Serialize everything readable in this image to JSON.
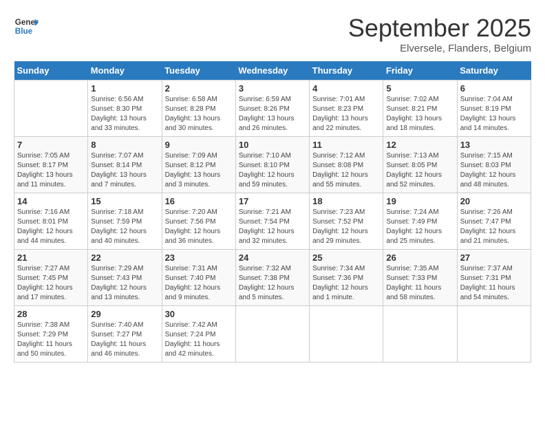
{
  "header": {
    "logo_line1": "General",
    "logo_line2": "Blue",
    "month": "September 2025",
    "location": "Elversele, Flanders, Belgium"
  },
  "days_of_week": [
    "Sunday",
    "Monday",
    "Tuesday",
    "Wednesday",
    "Thursday",
    "Friday",
    "Saturday"
  ],
  "weeks": [
    [
      null,
      {
        "num": "1",
        "sunrise": "6:56 AM",
        "sunset": "8:30 PM",
        "daylight": "13 hours and 33 minutes."
      },
      {
        "num": "2",
        "sunrise": "6:58 AM",
        "sunset": "8:28 PM",
        "daylight": "13 hours and 30 minutes."
      },
      {
        "num": "3",
        "sunrise": "6:59 AM",
        "sunset": "8:26 PM",
        "daylight": "13 hours and 26 minutes."
      },
      {
        "num": "4",
        "sunrise": "7:01 AM",
        "sunset": "8:23 PM",
        "daylight": "13 hours and 22 minutes."
      },
      {
        "num": "5",
        "sunrise": "7:02 AM",
        "sunset": "8:21 PM",
        "daylight": "13 hours and 18 minutes."
      },
      {
        "num": "6",
        "sunrise": "7:04 AM",
        "sunset": "8:19 PM",
        "daylight": "13 hours and 14 minutes."
      }
    ],
    [
      {
        "num": "7",
        "sunrise": "7:05 AM",
        "sunset": "8:17 PM",
        "daylight": "13 hours and 11 minutes."
      },
      {
        "num": "8",
        "sunrise": "7:07 AM",
        "sunset": "8:14 PM",
        "daylight": "13 hours and 7 minutes."
      },
      {
        "num": "9",
        "sunrise": "7:09 AM",
        "sunset": "8:12 PM",
        "daylight": "13 hours and 3 minutes."
      },
      {
        "num": "10",
        "sunrise": "7:10 AM",
        "sunset": "8:10 PM",
        "daylight": "12 hours and 59 minutes."
      },
      {
        "num": "11",
        "sunrise": "7:12 AM",
        "sunset": "8:08 PM",
        "daylight": "12 hours and 55 minutes."
      },
      {
        "num": "12",
        "sunrise": "7:13 AM",
        "sunset": "8:05 PM",
        "daylight": "12 hours and 52 minutes."
      },
      {
        "num": "13",
        "sunrise": "7:15 AM",
        "sunset": "8:03 PM",
        "daylight": "12 hours and 48 minutes."
      }
    ],
    [
      {
        "num": "14",
        "sunrise": "7:16 AM",
        "sunset": "8:01 PM",
        "daylight": "12 hours and 44 minutes."
      },
      {
        "num": "15",
        "sunrise": "7:18 AM",
        "sunset": "7:59 PM",
        "daylight": "12 hours and 40 minutes."
      },
      {
        "num": "16",
        "sunrise": "7:20 AM",
        "sunset": "7:56 PM",
        "daylight": "12 hours and 36 minutes."
      },
      {
        "num": "17",
        "sunrise": "7:21 AM",
        "sunset": "7:54 PM",
        "daylight": "12 hours and 32 minutes."
      },
      {
        "num": "18",
        "sunrise": "7:23 AM",
        "sunset": "7:52 PM",
        "daylight": "12 hours and 29 minutes."
      },
      {
        "num": "19",
        "sunrise": "7:24 AM",
        "sunset": "7:49 PM",
        "daylight": "12 hours and 25 minutes."
      },
      {
        "num": "20",
        "sunrise": "7:26 AM",
        "sunset": "7:47 PM",
        "daylight": "12 hours and 21 minutes."
      }
    ],
    [
      {
        "num": "21",
        "sunrise": "7:27 AM",
        "sunset": "7:45 PM",
        "daylight": "12 hours and 17 minutes."
      },
      {
        "num": "22",
        "sunrise": "7:29 AM",
        "sunset": "7:43 PM",
        "daylight": "12 hours and 13 minutes."
      },
      {
        "num": "23",
        "sunrise": "7:31 AM",
        "sunset": "7:40 PM",
        "daylight": "12 hours and 9 minutes."
      },
      {
        "num": "24",
        "sunrise": "7:32 AM",
        "sunset": "7:38 PM",
        "daylight": "12 hours and 5 minutes."
      },
      {
        "num": "25",
        "sunrise": "7:34 AM",
        "sunset": "7:36 PM",
        "daylight": "12 hours and 1 minute."
      },
      {
        "num": "26",
        "sunrise": "7:35 AM",
        "sunset": "7:33 PM",
        "daylight": "11 hours and 58 minutes."
      },
      {
        "num": "27",
        "sunrise": "7:37 AM",
        "sunset": "7:31 PM",
        "daylight": "11 hours and 54 minutes."
      }
    ],
    [
      {
        "num": "28",
        "sunrise": "7:38 AM",
        "sunset": "7:29 PM",
        "daylight": "11 hours and 50 minutes."
      },
      {
        "num": "29",
        "sunrise": "7:40 AM",
        "sunset": "7:27 PM",
        "daylight": "11 hours and 46 minutes."
      },
      {
        "num": "30",
        "sunrise": "7:42 AM",
        "sunset": "7:24 PM",
        "daylight": "11 hours and 42 minutes."
      },
      null,
      null,
      null,
      null
    ]
  ]
}
